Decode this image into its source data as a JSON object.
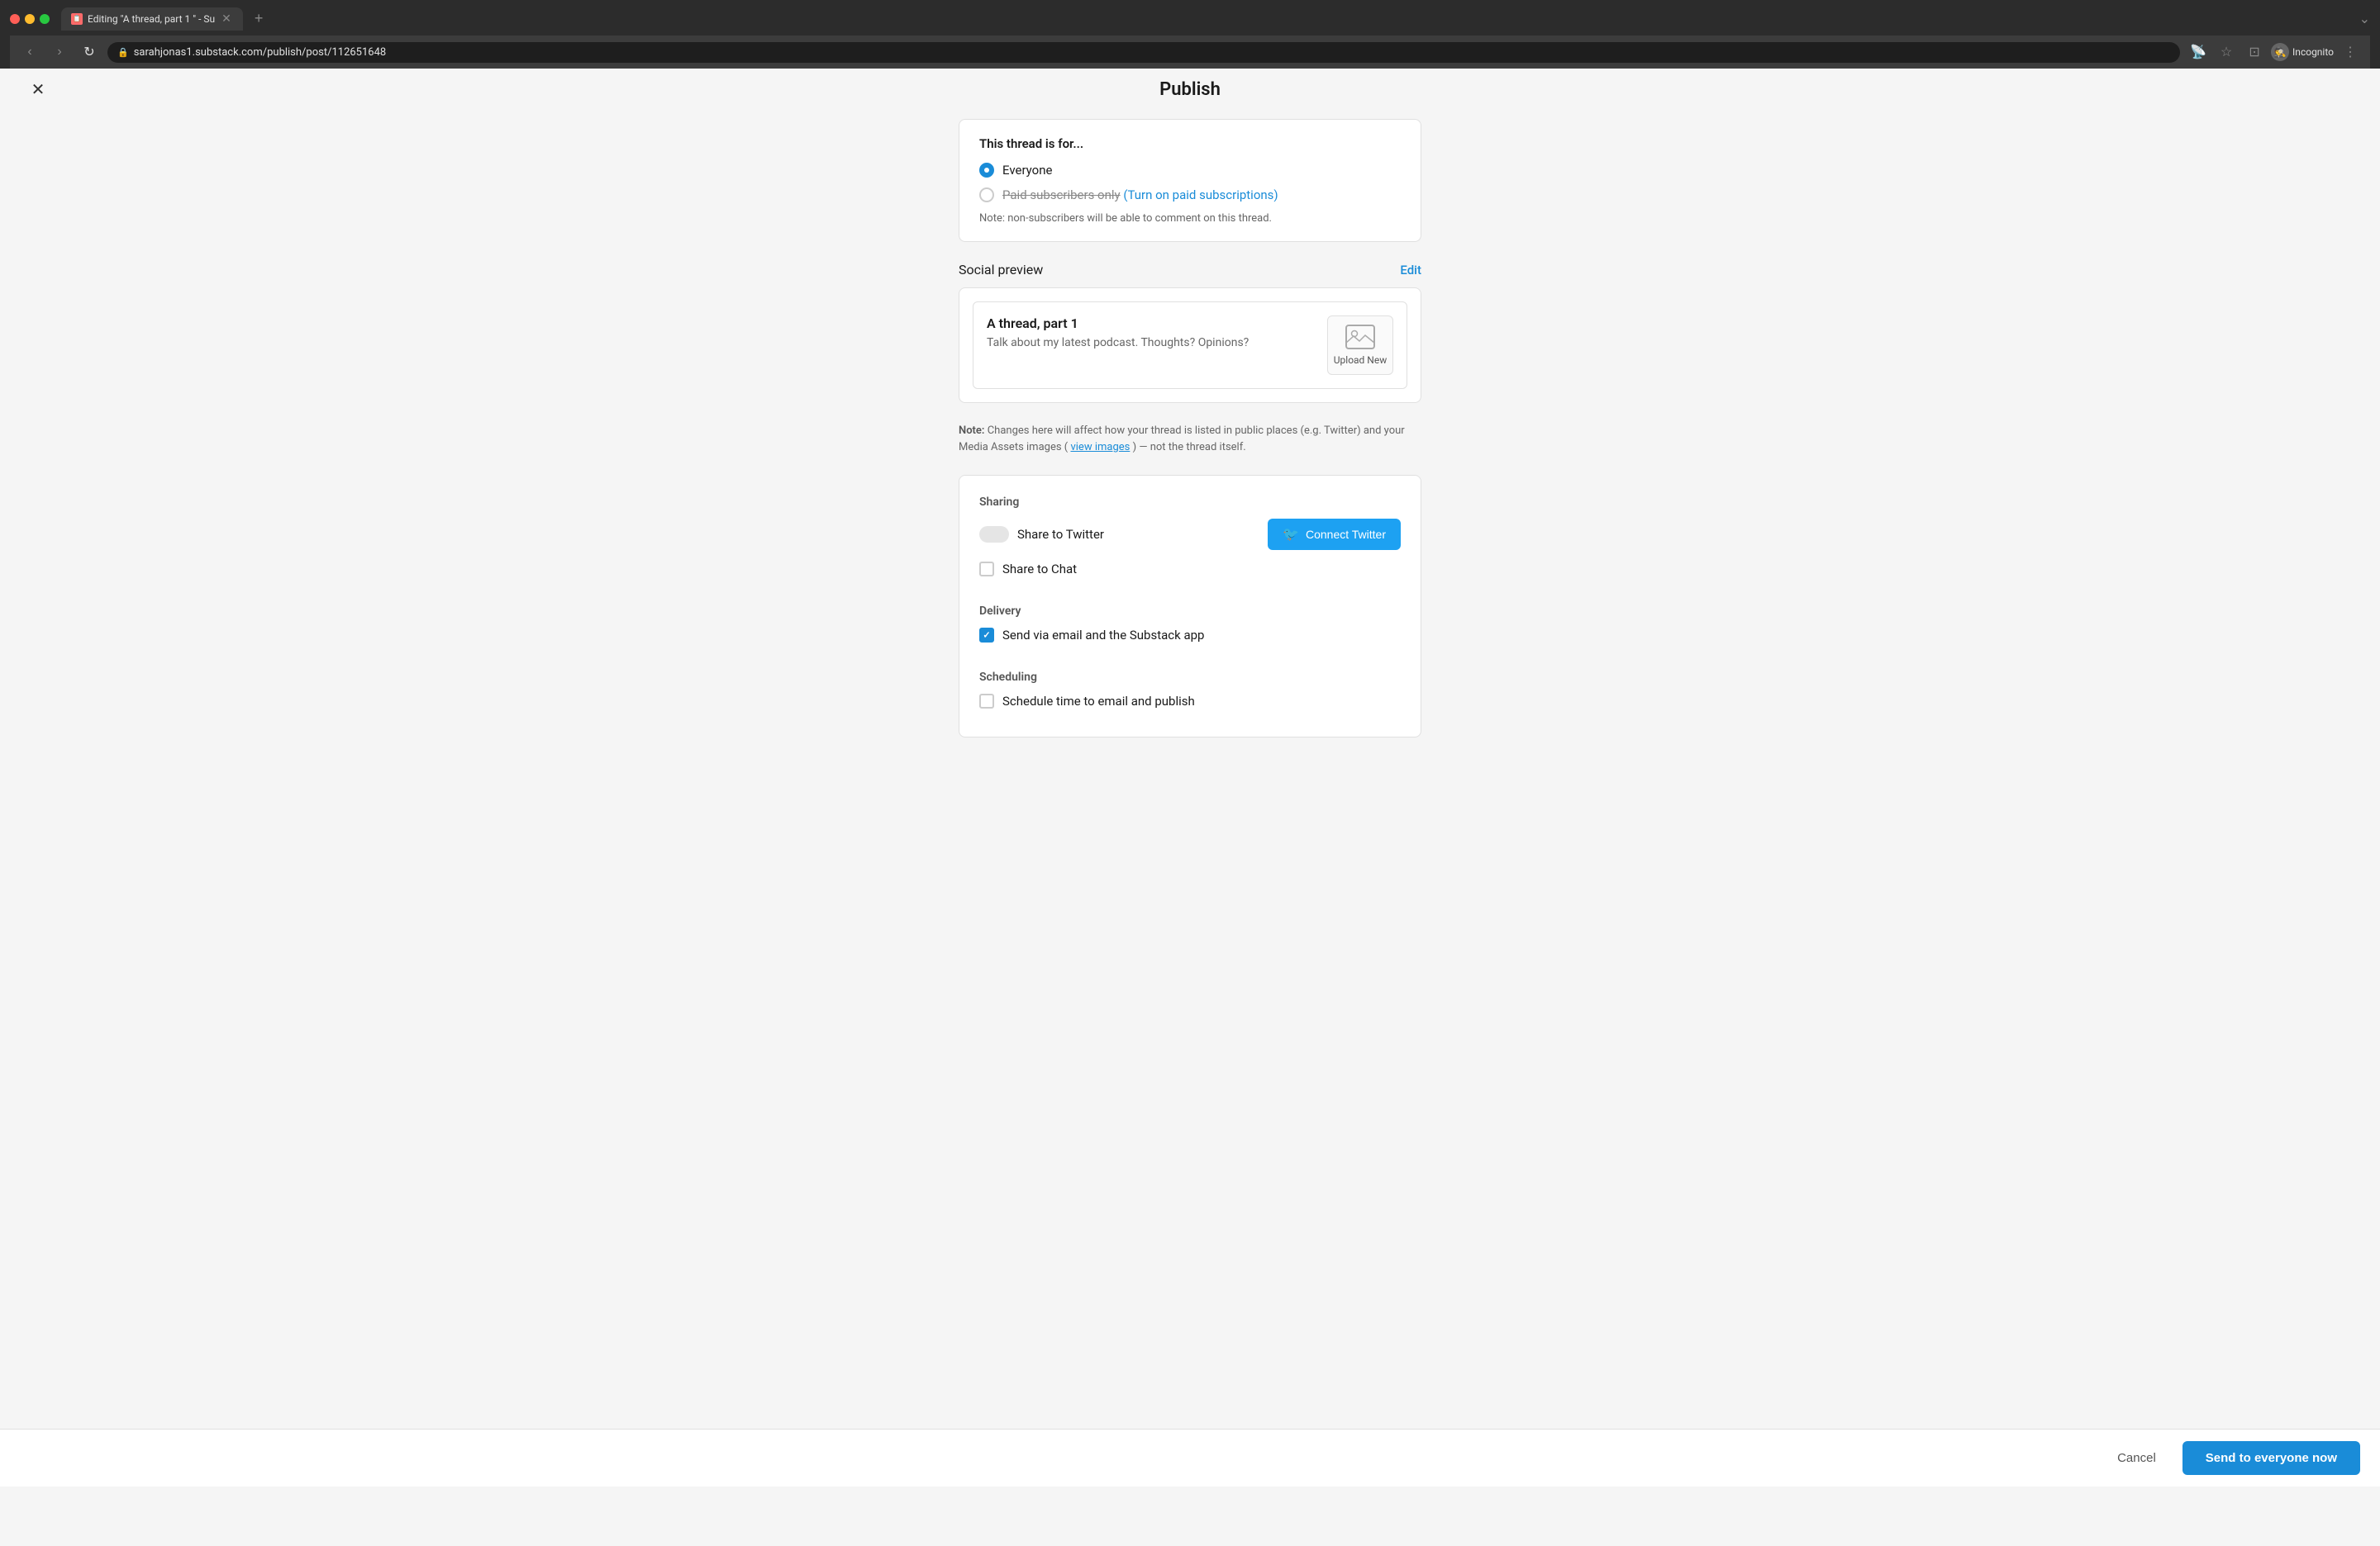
{
  "browser": {
    "tab_title": "Editing \"A thread, part 1 \" - Su",
    "tab_favicon": "📋",
    "url": "sarahjonas1.substack.com/publish/post/112651648",
    "incognito_label": "Incognito",
    "new_tab_label": "+",
    "nav_back": "‹",
    "nav_forward": "›",
    "nav_refresh": "↻"
  },
  "page": {
    "title": "Publish",
    "close_label": "✕"
  },
  "audience": {
    "heading": "This thread is for...",
    "everyone_label": "Everyone",
    "paid_label": "Paid subscribers only",
    "paid_link_label": "(Turn on paid subscriptions)",
    "note": "Note: non-subscribers will be able to comment on this thread.",
    "everyone_selected": true,
    "paid_selected": false
  },
  "social_preview": {
    "heading": "Social preview",
    "edit_label": "Edit",
    "title": "A thread, part 1",
    "description": "Talk about my latest podcast. Thoughts? Opinions?",
    "upload_label": "Upload New",
    "note_prefix": "Note:",
    "note_body": " Changes here will affect how your thread is listed in public places (e.g. Twitter) and your Media Assets images (",
    "note_link": "view images",
    "note_suffix": ") — not the thread itself."
  },
  "sharing": {
    "heading": "Sharing",
    "share_twitter_label": "Share to Twitter",
    "share_twitter_enabled": false,
    "connect_twitter_label": "Connect Twitter",
    "share_chat_label": "Share to Chat",
    "share_chat_checked": false
  },
  "delivery": {
    "heading": "Delivery",
    "send_email_label": "Send via email and the Substack app",
    "send_email_checked": true
  },
  "scheduling": {
    "heading": "Scheduling",
    "schedule_label": "Schedule time to email and publish",
    "schedule_checked": false
  },
  "footer": {
    "cancel_label": "Cancel",
    "publish_label": "Send to everyone now"
  }
}
